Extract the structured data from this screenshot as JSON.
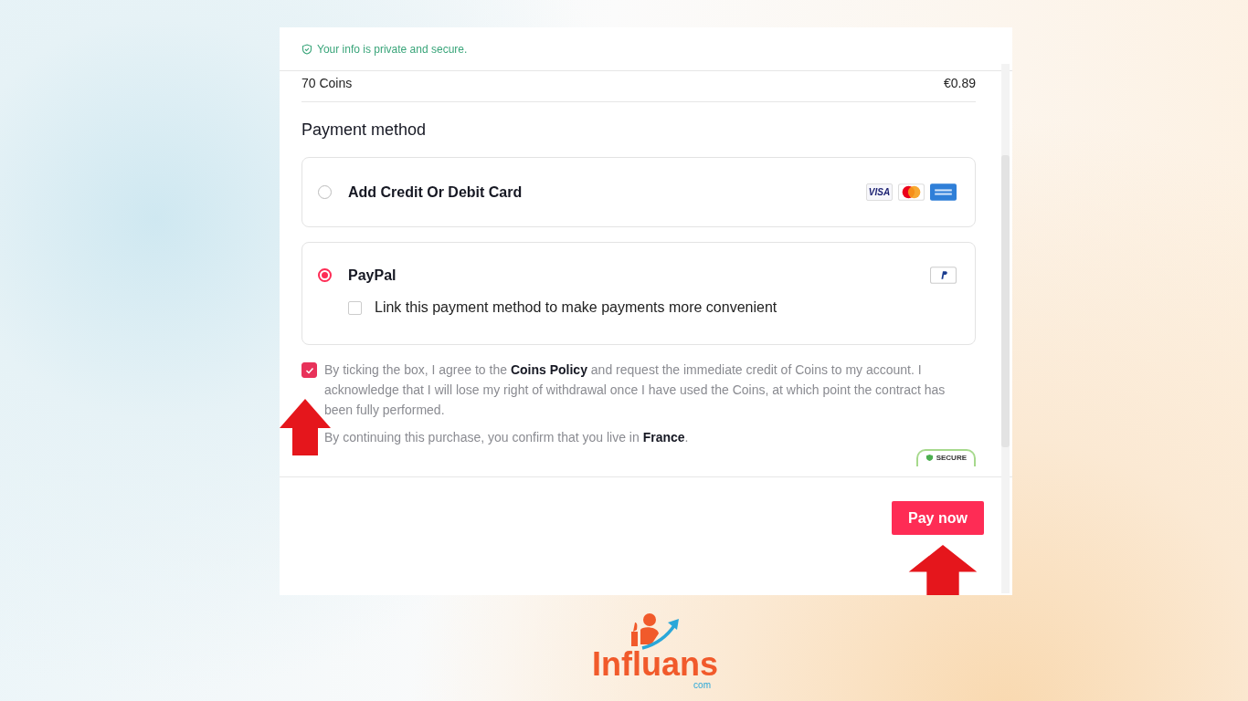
{
  "header": {
    "secure_note": "Your info is private and secure."
  },
  "order": {
    "item": "70 Coins",
    "price": "€0.89"
  },
  "payment": {
    "title": "Payment method",
    "options": [
      {
        "kind": "card",
        "label": "Add Credit Or Debit Card",
        "selected": false,
        "logos": [
          {
            "kind": "visa",
            "label": "VISA"
          },
          {
            "kind": "mastercard"
          },
          {
            "kind": "amex"
          }
        ]
      },
      {
        "kind": "paypal",
        "label": "PayPal",
        "selected": true,
        "logos": [
          {
            "kind": "paypal"
          }
        ],
        "link_option": {
          "label": "Link this payment method to make payments more convenient",
          "checked": false
        }
      }
    ]
  },
  "terms": {
    "checked": true,
    "text": "By ticking the box, I agree to the **Coins Policy** and request the immediate credit of Coins to my account. I acknowledge that I will lose my right of withdrawal once I have used the Coins, at which point the contract has been fully performed.",
    "residence": "By continuing this purchase, you confirm that you live in **France**."
  },
  "secure_badge": "SECURE",
  "pay_button": "Pay now",
  "brand": {
    "name": "Influans",
    "suffix": "com"
  }
}
